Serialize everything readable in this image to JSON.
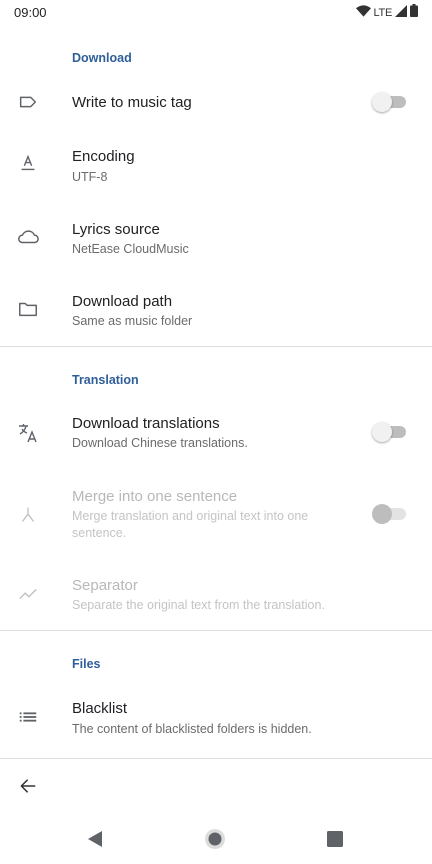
{
  "status_bar": {
    "time": "09:00",
    "network": "LTE",
    "icons": [
      "wifi-icon",
      "cell-signal-icon",
      "battery-icon"
    ]
  },
  "sections": {
    "download": {
      "header": "Download"
    },
    "translation": {
      "header": "Translation"
    },
    "files": {
      "header": "Files"
    }
  },
  "items": {
    "write_tag": {
      "title": "Write to music tag",
      "enabled": true,
      "toggle_on": false,
      "icon": "label-icon"
    },
    "encoding": {
      "title": "Encoding",
      "summary": "UTF-8",
      "enabled": true,
      "icon": "text-format-icon"
    },
    "lyrics_source": {
      "title": "Lyrics source",
      "summary": "NetEase CloudMusic",
      "enabled": true,
      "icon": "cloud-icon"
    },
    "download_path": {
      "title": "Download path",
      "summary": "Same as music folder",
      "enabled": true,
      "icon": "folder-icon"
    },
    "download_translations": {
      "title": "Download translations",
      "summary": "Download Chinese translations.",
      "enabled": true,
      "toggle_on": false,
      "icon": "translate-icon"
    },
    "merge_sentence": {
      "title": "Merge into one sentence",
      "summary": "Merge translation and original text into one sentence.",
      "enabled": false,
      "toggle_on": false,
      "icon": "merge-icon"
    },
    "separator": {
      "title": "Separator",
      "summary": "Separate the original text from the translation.",
      "enabled": false,
      "icon": "trending-icon"
    },
    "blacklist": {
      "title": "Blacklist",
      "summary": "The content of blacklisted folders is hidden.",
      "enabled": true,
      "icon": "list-icon"
    }
  },
  "navigation": {
    "back": "arrow-back-icon",
    "system": [
      "nav-back-icon",
      "nav-home-icon",
      "nav-recents-icon"
    ]
  },
  "colors": {
    "accent": "#2f5f9a",
    "text_primary": "#202124",
    "text_secondary": "#6b6b6b",
    "text_disabled": "#b8b8b8",
    "divider": "#dedede"
  }
}
